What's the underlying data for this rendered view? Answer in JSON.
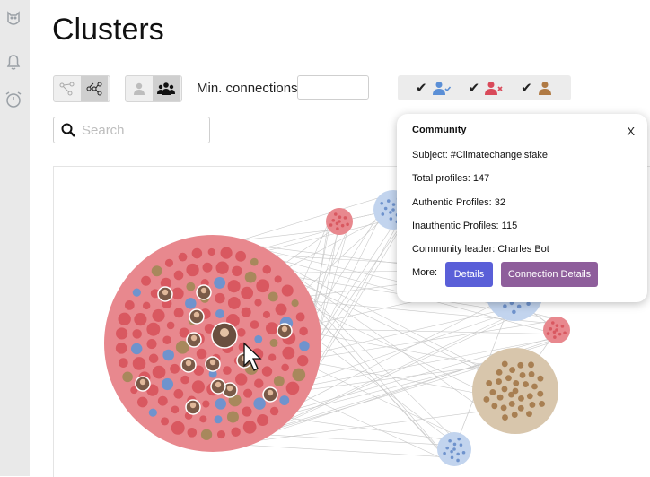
{
  "page": {
    "title": "Clusters"
  },
  "sidebar": {
    "icons": [
      {
        "name": "owl-icon"
      },
      {
        "name": "bell-icon"
      },
      {
        "name": "alarm-clock-icon"
      }
    ]
  },
  "toolbar": {
    "view_toggle": {
      "options": [
        "tree-view-icon",
        "network-view-icon"
      ],
      "selected": 1
    },
    "group_toggle": {
      "options": [
        "single-user-icon",
        "group-users-icon"
      ],
      "selected": 1
    },
    "min_connections_label": "Min. connections",
    "min_connections_value": "",
    "filters": [
      {
        "name": "authentic-users",
        "checked": true,
        "color": "#5b8fd6"
      },
      {
        "name": "inauthentic-users",
        "checked": true,
        "color": "#d94a5a"
      },
      {
        "name": "community-leaders",
        "checked": true,
        "color": "#b07a44"
      }
    ]
  },
  "search": {
    "placeholder": "Search"
  },
  "popup": {
    "title": "Community",
    "close_label": "X",
    "subject": "Subject: #Climatechangeisfake",
    "total": "Total profiles: 147",
    "authentic": "Authentic Profiles: 32",
    "inauthentic": "Inauthentic Profiles: 115",
    "leader": "Community leader: Charles Bot",
    "more_label": "More:",
    "details_button": "Details",
    "connection_button": "Connection Details"
  },
  "colors": {
    "inauthentic": "#e8888e",
    "authentic": "#c2d4ee",
    "leader": "#d8c6ac",
    "details_button": "#5a5fd8",
    "connection_button": "#8e5e9b"
  }
}
